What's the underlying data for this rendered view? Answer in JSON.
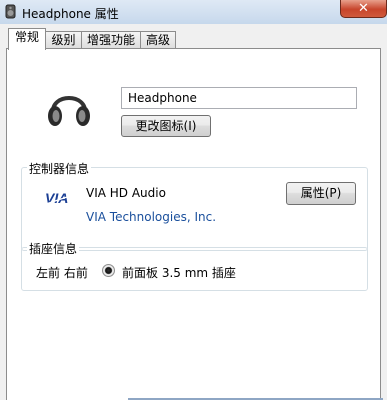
{
  "window": {
    "title": "Headphone 属性",
    "close_glyph": "✕",
    "icon": "speaker-icon"
  },
  "tabs": [
    {
      "label": "常规",
      "active": true
    },
    {
      "label": "级别",
      "active": false
    },
    {
      "label": "增强功能",
      "active": false
    },
    {
      "label": "高级",
      "active": false
    }
  ],
  "general": {
    "device_icon": "headphone-icon",
    "device_name": "Headphone",
    "change_icon_label": "更改图标(I)"
  },
  "controller": {
    "group_label": "控制器信息",
    "logo": "via-logo",
    "logo_text": "VIA",
    "name": "VIA HD Audio",
    "vendor": "VIA Technologies, Inc.",
    "properties_label": "属性(P)"
  },
  "jack": {
    "group_label": "插座信息",
    "position": "左前 右前",
    "description": "前面板 3.5 mm 插座",
    "selected": true
  },
  "colors": {
    "titlebar": "#c6d8ec",
    "close": "#c7452c",
    "link": "#1a4f9c"
  }
}
